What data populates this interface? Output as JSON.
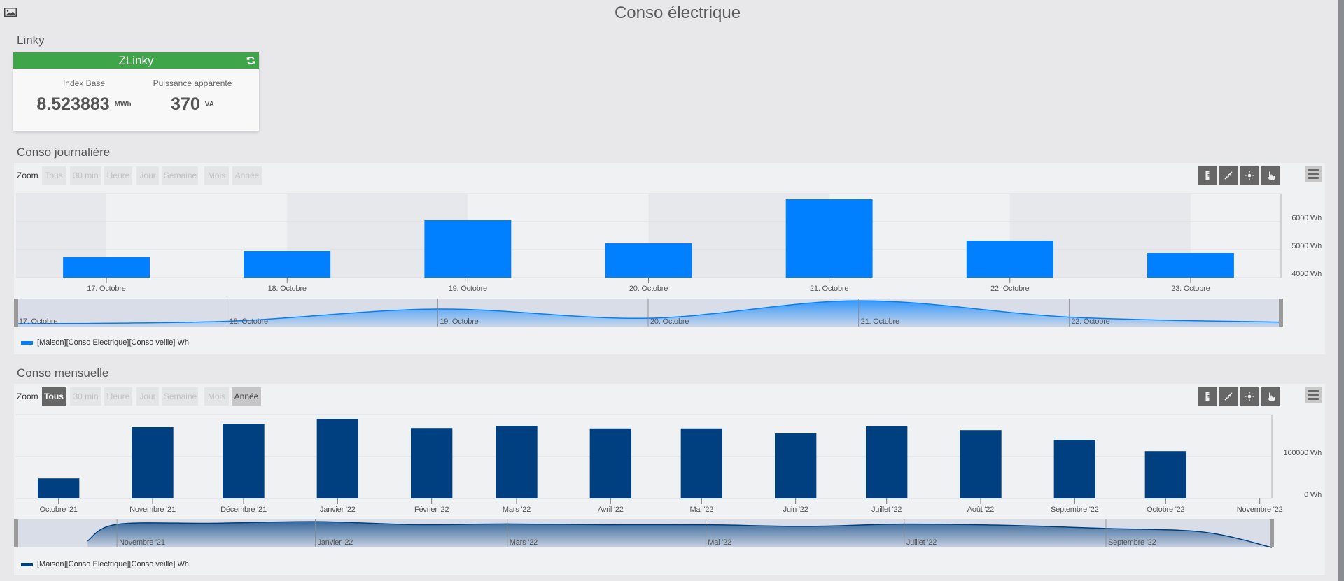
{
  "page": {
    "title": "Conso électrique",
    "corner_icon": "image-icon"
  },
  "linky": {
    "heading": "Linky",
    "card": {
      "title": "ZLinky",
      "header_color": "#3ea648",
      "refresh_icon": "refresh-icon",
      "metrics": [
        {
          "label": "Index Base",
          "value": "8.523883",
          "unit": "MWh"
        },
        {
          "label": "Puissance apparente",
          "value": "370",
          "unit": "VA"
        }
      ]
    }
  },
  "daily": {
    "heading": "Conso journalière",
    "zoom_label": "Zoom",
    "zoom_buttons": [
      {
        "label": "Tous",
        "state": "disabled"
      },
      {
        "label": "30 min",
        "state": "disabled"
      },
      {
        "label": "Heure",
        "state": "disabled"
      },
      {
        "label": "Jour",
        "state": "disabled"
      },
      {
        "label": "Semaine",
        "state": "disabled"
      },
      {
        "label": "Mois",
        "state": "disabled"
      },
      {
        "label": "Année",
        "state": "disabled"
      }
    ],
    "tools": [
      "ruler-icon",
      "compress-icon",
      "sun-icon",
      "hand-pointer-icon"
    ],
    "menu_icon": "hamburger-menu-icon"
  },
  "monthly": {
    "heading": "Conso mensuelle",
    "zoom_label": "Zoom",
    "zoom_buttons": [
      {
        "label": "Tous",
        "state": "selected"
      },
      {
        "label": "30 min",
        "state": "disabled"
      },
      {
        "label": "Heure",
        "state": "disabled"
      },
      {
        "label": "Jour",
        "state": "disabled"
      },
      {
        "label": "Semaine",
        "state": "disabled"
      },
      {
        "label": "Mois",
        "state": "disabled"
      },
      {
        "label": "Année",
        "state": "hover"
      }
    ],
    "tools": [
      "ruler-icon",
      "compress-icon",
      "sun-icon",
      "hand-pointer-icon"
    ],
    "menu_icon": "hamburger-menu-icon"
  },
  "chart_data": [
    {
      "id": "daily",
      "type": "bar",
      "title": "Conso journalière",
      "xlabel": "",
      "ylabel": "",
      "categories": [
        "17. Octobre",
        "18. Octobre",
        "19. Octobre",
        "20. Octobre",
        "21. Octobre",
        "22. Octobre",
        "23. Octobre"
      ],
      "series": [
        {
          "name": "[Maison][Conso Electrique][Conso veille] Wh",
          "color": "#0080ff",
          "values": [
            4725,
            4950,
            6050,
            5225,
            6800,
            5325,
            4875
          ]
        }
      ],
      "ylim": [
        4000,
        7000
      ],
      "y_gridlines": [
        4000,
        5000,
        6000,
        7000
      ],
      "y_ticks": [
        4000,
        5000,
        6000
      ],
      "y_tick_labels": [
        "4000 Wh",
        "5000 Wh",
        "6000 Wh"
      ],
      "y_axis_side": "right",
      "grid": true,
      "alternate_bands": true,
      "legend": "bottom-left",
      "navigator": {
        "type": "area",
        "x_labels": [
          "17. Octobre",
          "18. Octobre",
          "19. Octobre",
          "20. Octobre",
          "21. Octobre",
          "22. Octobre"
        ],
        "ylim": [
          4475,
          7000
        ]
      }
    },
    {
      "id": "monthly",
      "type": "bar",
      "title": "Conso mensuelle",
      "xlabel": "",
      "ylabel": "",
      "x": [
        "2021-10-01",
        "2021-11-01",
        "2021-12-01",
        "2022-01-01",
        "2022-02-01",
        "2022-03-01",
        "2022-04-01",
        "2022-05-01",
        "2022-06-01",
        "2022-07-01",
        "2022-08-01",
        "2022-09-01",
        "2022-10-01"
      ],
      "categories": [
        "Octobre '21",
        "Novembre '21",
        "Décembre '21",
        "Janvier '22",
        "Février '22",
        "Mars '22",
        "Avril '22",
        "Mai '22",
        "Juin '22",
        "Juillet '22",
        "Août '22",
        "Septembre '22",
        "Octobre '22"
      ],
      "x_ticks": [
        {
          "date": "2021-10-01",
          "label": "Octobre '21"
        },
        {
          "date": "2021-11-01",
          "label": "Novembre '21"
        },
        {
          "date": "2021-12-01",
          "label": "Décembre '21"
        },
        {
          "date": "2022-01-01",
          "label": "Janvier '22"
        },
        {
          "date": "2022-02-01",
          "label": "Février '22"
        },
        {
          "date": "2022-03-01",
          "label": "Mars '22"
        },
        {
          "date": "2022-04-01",
          "label": "Avril '22"
        },
        {
          "date": "2022-05-01",
          "label": "Mai '22"
        },
        {
          "date": "2022-06-01",
          "label": "Juin '22"
        },
        {
          "date": "2022-07-01",
          "label": "Juillet '22"
        },
        {
          "date": "2022-08-01",
          "label": "Août '22"
        },
        {
          "date": "2022-09-01",
          "label": "Septembre '22"
        },
        {
          "date": "2022-10-01",
          "label": "Octobre '22"
        },
        {
          "date": "2022-11-01",
          "label": "Novembre '22"
        }
      ],
      "series": [
        {
          "name": "[Maison][Conso Electrique][Conso veille] Wh",
          "color": "#004080",
          "values": [
            48000,
            170000,
            178000,
            190000,
            168000,
            173000,
            167000,
            167000,
            155000,
            172000,
            163000,
            140000,
            113000
          ]
        }
      ],
      "xlim": [
        "2021-09-17",
        "2022-11-05"
      ],
      "ylim": [
        0,
        200000
      ],
      "y_gridlines": [
        0,
        100000,
        200000
      ],
      "y_ticks": [
        0,
        100000
      ],
      "y_tick_labels": [
        "0 Wh",
        "100000 Wh"
      ],
      "y_axis_side": "right",
      "grid": true,
      "alternate_bands": false,
      "legend": "bottom-left",
      "navigator": {
        "type": "area",
        "xlim": [
          "2021-10-01",
          "2022-10-22"
        ],
        "ylim": [
          0,
          206000
        ],
        "x_ticks": [
          {
            "date": "2021-11-01",
            "label": "Novembre '21"
          },
          {
            "date": "2022-01-01",
            "label": "Janvier '22"
          },
          {
            "date": "2022-03-01",
            "label": "Mars '22"
          },
          {
            "date": "2022-05-01",
            "label": "Mai '22"
          },
          {
            "date": "2022-07-01",
            "label": "Juillet '22"
          },
          {
            "date": "2022-09-01",
            "label": "Septembre '22"
          }
        ],
        "points": [
          [
            "2021-10-23",
            48000
          ],
          [
            "2021-11-01",
            170000
          ],
          [
            "2021-12-01",
            178000
          ],
          [
            "2022-01-01",
            190000
          ],
          [
            "2022-02-01",
            168000
          ],
          [
            "2022-03-01",
            173000
          ],
          [
            "2022-04-01",
            167000
          ],
          [
            "2022-05-01",
            167000
          ],
          [
            "2022-06-01",
            155000
          ],
          [
            "2022-07-01",
            172000
          ],
          [
            "2022-08-01",
            163000
          ],
          [
            "2022-09-01",
            140000
          ],
          [
            "2022-10-01",
            113000
          ],
          [
            "2022-10-22",
            0
          ]
        ]
      }
    }
  ]
}
